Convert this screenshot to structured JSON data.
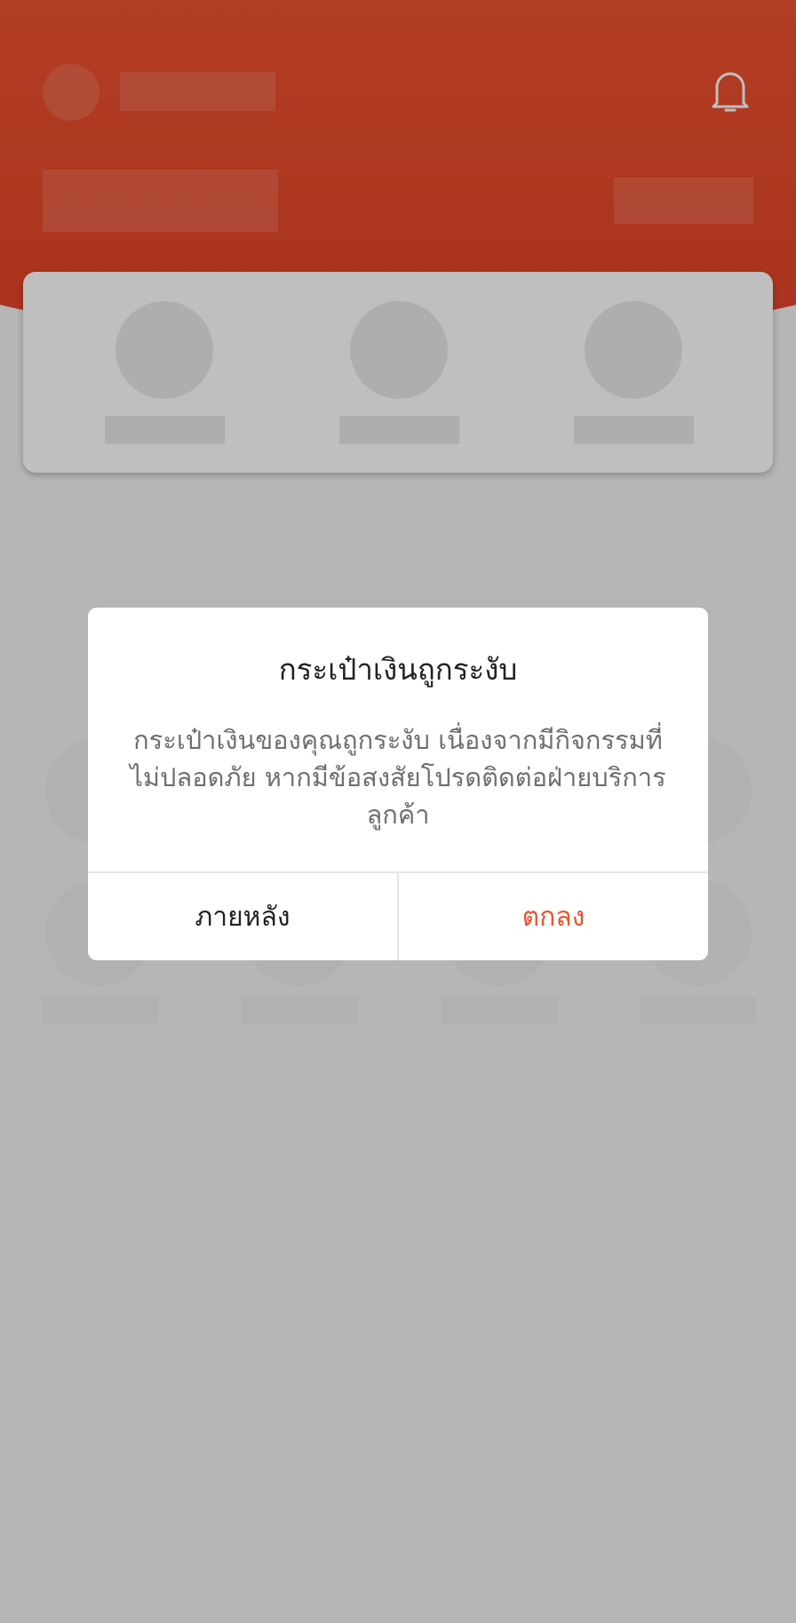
{
  "header": {
    "background_color": "#ee5330",
    "notification_icon": "bell-icon"
  },
  "dialog": {
    "title": "กระเป๋าเงินถูกระงับ",
    "message": "กระเป๋าเงินของคุณถูกระงับ เนื่องจากมีกิจกรรมที่ไม่ปลอดภัย หากมีข้อสงสัยโปรดติดต่อฝ่ายบริการลูกค้า",
    "buttons": {
      "later": "ภายหลัง",
      "ok": "ตกลง"
    },
    "ok_color": "#e9542f"
  }
}
